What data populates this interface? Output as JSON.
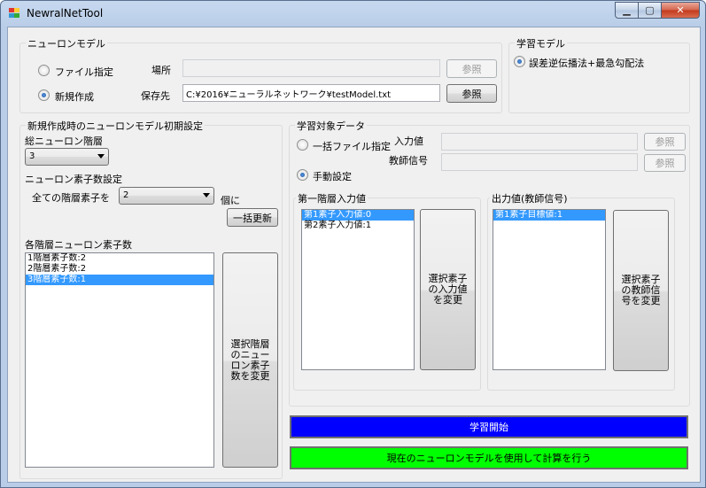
{
  "window": {
    "title": "NewralNetTool",
    "min": "▁",
    "max": "▢",
    "close": "✕"
  },
  "neuron_model": {
    "legend": "ニューロンモデル",
    "file_radio": "ファイル指定",
    "new_radio": "新規作成",
    "location_label": "場所",
    "location_value": "",
    "save_label": "保存先",
    "save_value": "C:¥2016¥ニューラルネットワーク¥testModel.txt",
    "browse1": "参照",
    "browse2": "参照"
  },
  "learning_model": {
    "legend": "学習モデル",
    "option": "誤差逆伝播法+最急勾配法"
  },
  "init_settings": {
    "legend": "新規作成時のニューロンモデル初期設定",
    "total_layers_label": "総ニューロン階層",
    "total_layers_value": "3",
    "neuron_count_label": "ニューロン素子数設定",
    "all_layers_label": "全ての階層素子を",
    "all_layers_value": "2",
    "unit_label": "個に",
    "bulk_update": "一括更新",
    "per_layer_label": "各階層ニューロン素子数",
    "layer_items": [
      "1階層素子数:2",
      "2階層素子数:2",
      "3階層素子数:1"
    ],
    "change_button": "選択階層のニューロン素子数を変更"
  },
  "training_data": {
    "legend": "学習対象データ",
    "bulk_file_radio": "一括ファイル指定",
    "input_label": "入力値",
    "teacher_label": "教師信号",
    "browse_input": "参照",
    "browse_teacher": "参照",
    "manual_radio": "手動設定",
    "first_input_legend": "第一階層入力値",
    "input_items": [
      "第1素子入力値:0",
      "第2素子入力値:1"
    ],
    "change_input_button": "選択素子の入力値を変更",
    "output_legend": "出力値(教師信号)",
    "output_items": [
      "第1素子目標値:1"
    ],
    "change_teacher_button": "選択素子の教師信号を変更"
  },
  "actions": {
    "start_learning": "学習開始",
    "compute": "現在のニューロンモデルを使用して計算を行う"
  },
  "colors": {
    "start_bg": "#0000ff",
    "compute_bg": "#00ff00",
    "selection": "#3399ff"
  }
}
